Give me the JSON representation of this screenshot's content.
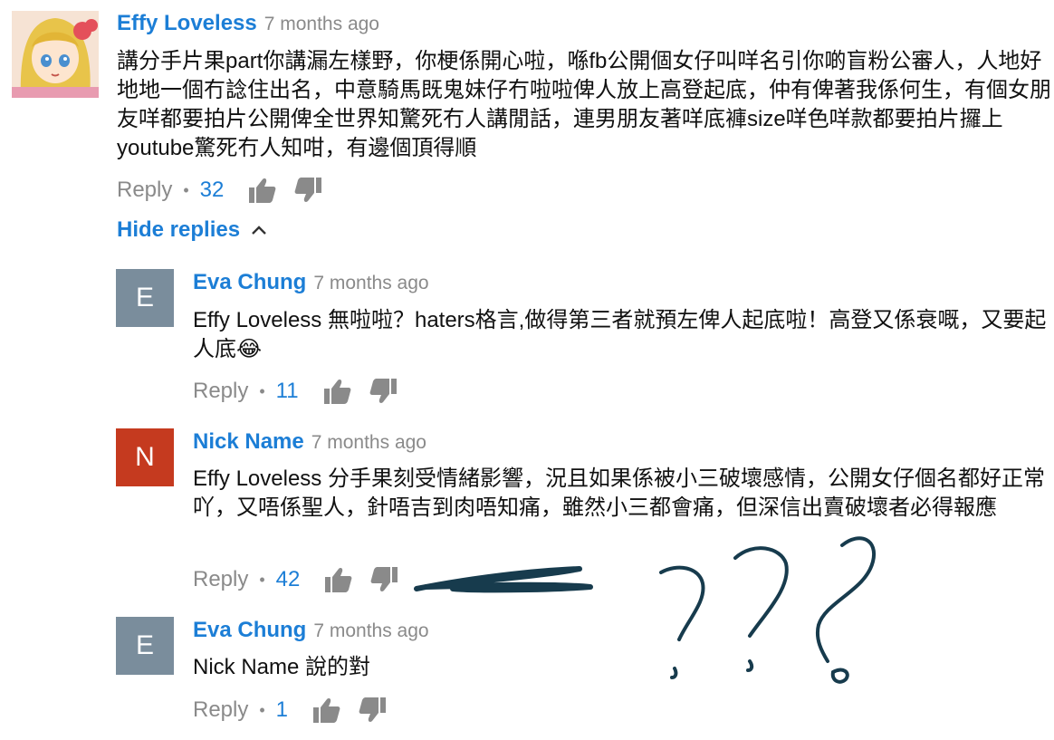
{
  "colors": {
    "link": "#1c7ed6",
    "meta": "#8a8a8a",
    "avatar_gray": "#7a8d9c",
    "avatar_red": "#c53a1f",
    "ink": "#173b4d"
  },
  "top_comment": {
    "author": "Effy Loveless",
    "time": "7 months ago",
    "text": "講分手片果part你講漏左樣野，你梗係開心啦，喺fb公開個女仔叫咩名引你啲盲粉公審人，人地好地地一個冇諗住出名，中意騎馬既鬼妹仔冇啦啦俾人放上高登起底，仲有俾著我係何生，有個女朋友咩都要拍片公開俾全世界知驚死冇人講閒話，連男朋友著咩底褲size咩色咩款都要拍片攞上youtube驚死冇人知咁，有邊個頂得順",
    "reply_label": "Reply",
    "likes": "32"
  },
  "hide_replies_label": "Hide replies",
  "replies": [
    {
      "initial": "E",
      "author": "Eva Chung",
      "time": "7 months ago",
      "text": "Effy Loveless 無啦啦？haters格言,做得第三者就預左俾人起底啦！高登又係衰嘅，又要起人底😂",
      "reply_label": "Reply",
      "likes": "11"
    },
    {
      "initial": "N",
      "author": "Nick Name",
      "time": "7 months ago",
      "text": "Effy Loveless 分手果刻受情緒影響，況且如果係被小三破壞感情，公開女仔個名都好正常吖，又唔係聖人，針唔吉到肉唔知痛，雖然小三都會痛，但深信出賣破壞者必得報應",
      "reply_label": "Reply",
      "likes": "42"
    },
    {
      "initial": "E",
      "author": "Eva Chung",
      "time": "7 months ago",
      "text": "Nick Name 說的對",
      "reply_label": "Reply",
      "likes": "1"
    }
  ],
  "icons": {
    "like": "thumbs-up-icon",
    "dislike": "thumbs-down-icon",
    "chevron": "chevron-up-icon"
  }
}
